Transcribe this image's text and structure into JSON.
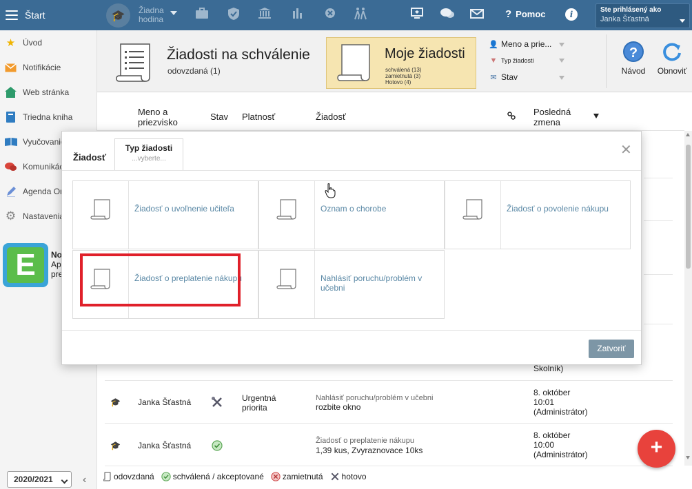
{
  "topbar": {
    "start_label": "Štart",
    "no_hour_label": "Žiadna hodina",
    "help_label": "Pomoc",
    "user_box_title": "Ste prihlásený ako",
    "user_name": "Janka Šťastná",
    "bg_color": "#3b6b95"
  },
  "sidebar": {
    "items": [
      {
        "label": "Úvod",
        "icon": "star-icon"
      },
      {
        "label": "Notifikácie",
        "icon": "envelope-icon"
      },
      {
        "label": "Web stránka",
        "icon": "home-icon"
      },
      {
        "label": "Triedna kniha",
        "icon": "book-icon"
      },
      {
        "label": "Vyučovanie",
        "icon": "open-book-icon"
      },
      {
        "label": "Komunikácia",
        "icon": "chat-icon"
      },
      {
        "label": "Agenda Org",
        "icon": "pencil-icon"
      },
      {
        "label": "Nastavenia",
        "icon": "gear-icon"
      }
    ],
    "promo": {
      "line1": "No",
      "line2": "Ap",
      "line3": "pre"
    },
    "year": "2020/2021"
  },
  "header": {
    "title": "Žiadosti na schválenie",
    "subtitle": "odovzdaná (1)",
    "my_requests": {
      "title": "Moje žiadosti",
      "approved": "schválená (13)",
      "rejected": "zamietnutá (3)",
      "done": "Hotovo (4)",
      "bg_color": "#f6e5b1"
    },
    "filters": {
      "name": "Meno a prie...",
      "type": "Typ žiadosti",
      "state": "Stav"
    },
    "guide_label": "Návod",
    "refresh_label": "Obnoviť"
  },
  "table": {
    "columns": {
      "name": "Meno a priezvisko",
      "state": "Stav",
      "validity": "Platnosť",
      "request": "Žiadosť",
      "last_change": "Posledná zmena"
    },
    "rows": [
      {
        "name": "",
        "priority": "",
        "type": "",
        "detail": "",
        "date": "",
        "time": "",
        "by": "Školník)"
      },
      {
        "name": "Janka Šťastná",
        "priority": "Urgentná priorita",
        "type": "Nahlásiť poruchu/problém v učebni",
        "detail": "rozbite okno",
        "date": "8. október",
        "time": "10:01",
        "by": "(Administrátor)"
      },
      {
        "name": "Janka Šťastná",
        "priority": "",
        "type": "Žiadosť o preplatenie nákupu",
        "detail": "1,39 kus, Zvyraznovace 10ks",
        "date": "8. október",
        "time": "10:00",
        "by": "(Administrátor)"
      }
    ]
  },
  "legend": {
    "submitted": "odovzdaná",
    "approved": "schválená / akceptované",
    "rejected": "zamietnutá",
    "done": "hotovo"
  },
  "modal": {
    "tab_request": "Žiadosť",
    "tab_type": "Typ žiadosti",
    "tab_type_placeholder": "...vyberte...",
    "cards": [
      {
        "label": "Žiadosť o uvoľnenie učiteľa"
      },
      {
        "label": "Oznam o chorobe"
      },
      {
        "label": "Žiadosť o povolenie nákupu"
      },
      {
        "label": "Žiadosť o preplatenie nákupu"
      },
      {
        "label": "Nahlásiť poruchu/problém v učebni"
      }
    ],
    "close_label": "Zatvoriť",
    "highlight_color": "#e0202a"
  },
  "fab_label": "+"
}
